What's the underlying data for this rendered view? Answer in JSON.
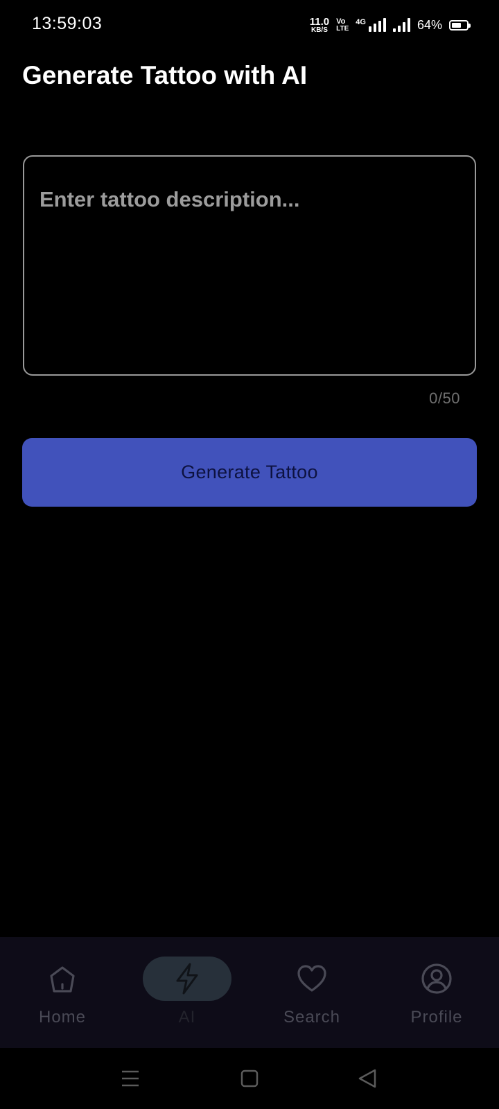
{
  "status_bar": {
    "time": "13:59:03",
    "net_speed_value": "11.0",
    "net_speed_unit": "KB/S",
    "volte_top": "Vo",
    "volte_bottom": "LTE",
    "network_type": "4G",
    "battery_percent": "64%",
    "battery_level": 0.64
  },
  "header": {
    "title": "Generate Tattoo with AI"
  },
  "description_input": {
    "placeholder": "Enter tattoo description...",
    "value": "",
    "char_count": "0/50"
  },
  "generate_button": {
    "label": "Generate Tattoo"
  },
  "bottom_nav": {
    "active": "AI",
    "items": [
      {
        "label": "Home",
        "icon": "home-icon"
      },
      {
        "label": "AI",
        "icon": "lightning-icon"
      },
      {
        "label": "Search",
        "icon": "heart-icon"
      },
      {
        "label": "Profile",
        "icon": "user-circle-icon"
      }
    ]
  },
  "system_nav": {
    "icons": [
      "menu-icon",
      "square-home-icon",
      "triangle-back-icon"
    ]
  },
  "colors": {
    "background": "#000000",
    "accent": "#4152bb",
    "nav_background": "#0e0c18",
    "active_pill": "#27303a"
  }
}
